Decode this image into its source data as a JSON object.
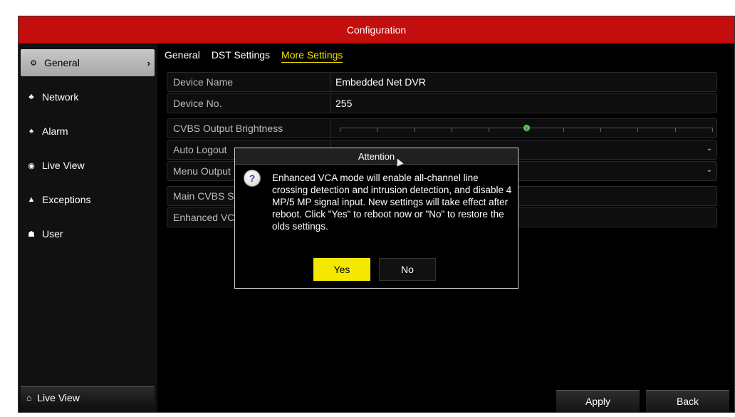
{
  "window": {
    "title": "Configuration"
  },
  "sidebar": {
    "items": [
      {
        "label": "General",
        "icon": "gear-icon",
        "glyph": "⚙"
      },
      {
        "label": "Network",
        "icon": "network-icon",
        "glyph": "♣"
      },
      {
        "label": "Alarm",
        "icon": "alarm-icon",
        "glyph": "♠"
      },
      {
        "label": "Live View",
        "icon": "eye-icon",
        "glyph": "◉"
      },
      {
        "label": "Exceptions",
        "icon": "warning-icon",
        "glyph": "▲"
      },
      {
        "label": "User",
        "icon": "user-icon",
        "glyph": "☗"
      }
    ],
    "active_chevron": "›",
    "bottom_button": {
      "label": "Live View",
      "icon": "home-icon",
      "glyph": "⌂"
    }
  },
  "tabs": [
    {
      "label": "General"
    },
    {
      "label": "DST Settings"
    },
    {
      "label": "More Settings",
      "active": true
    }
  ],
  "settings": {
    "device_name": {
      "label": "Device Name",
      "value": "Embedded Net DVR"
    },
    "device_no": {
      "label": "Device No.",
      "value": "255"
    },
    "cvbs_brightness": {
      "label": "CVBS Output Brightness",
      "level_fraction": 0.5
    },
    "auto_logout": {
      "label": "Auto Logout"
    },
    "menu_output": {
      "label": "Menu Output"
    },
    "main_cvbs": {
      "label": "Main CVBS S"
    },
    "enhanced_vca": {
      "label": "Enhanced VC"
    }
  },
  "footer": {
    "apply_label": "Apply",
    "back_label": "Back"
  },
  "dialog": {
    "title": "Attention",
    "icon": "question-icon",
    "icon_glyph": "?",
    "message": "Enhanced VCA mode will enable all-channel line crossing detection and intrusion detection, and disable 4 MP/5 MP signal input. New settings will take effect after reboot. Click \"Yes\" to reboot now or \"No\" to restore the olds settings.",
    "yes_label": "Yes",
    "no_label": "No"
  },
  "colors": {
    "titlebar": "#c40d0d",
    "accent": "#f4e800",
    "slider": "#3fbf3f"
  }
}
